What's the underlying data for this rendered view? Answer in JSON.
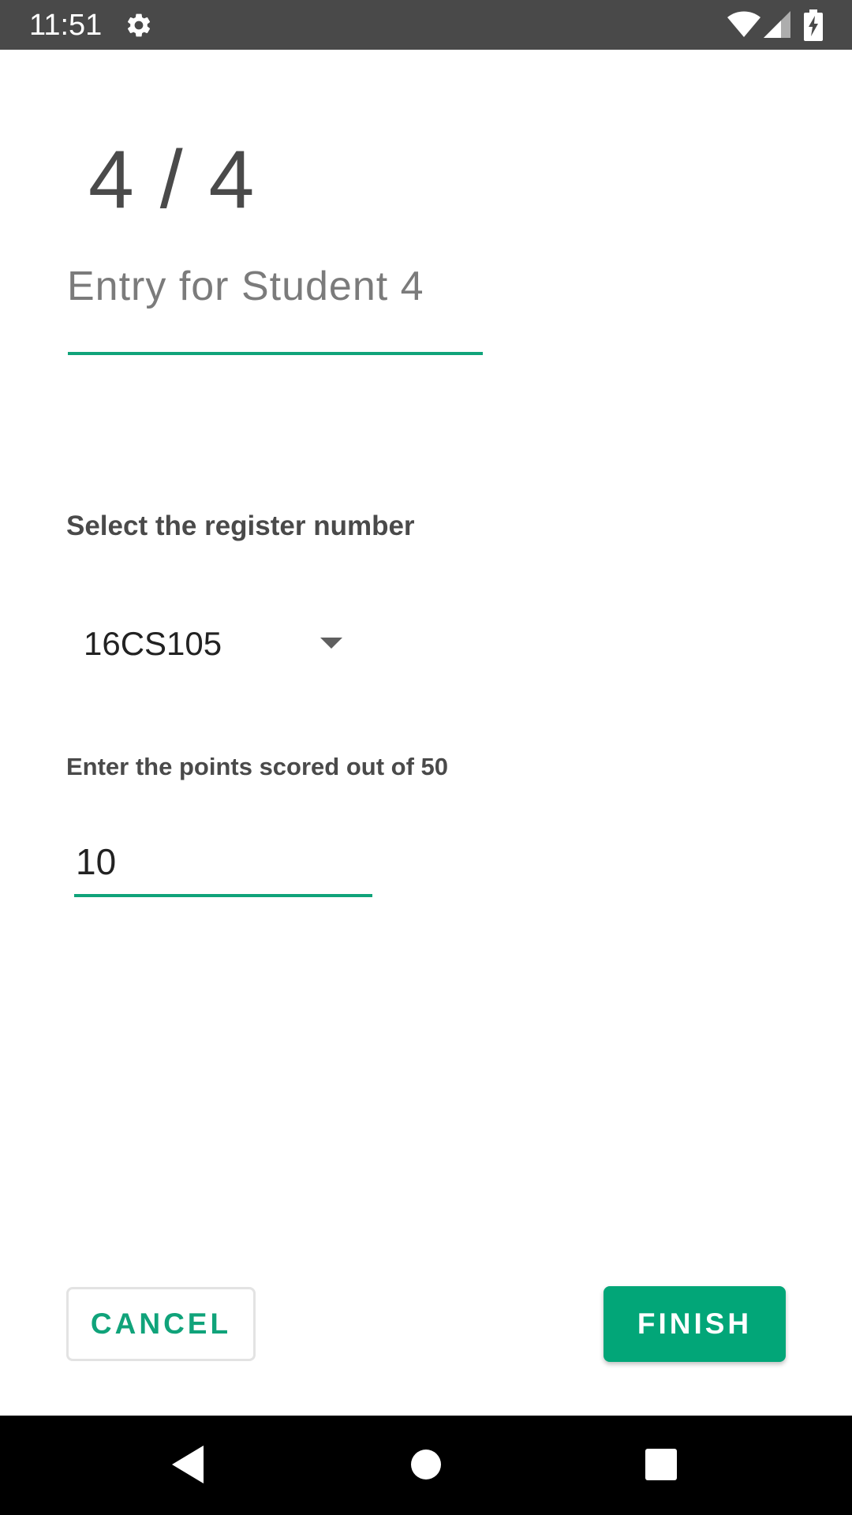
{
  "status_bar": {
    "time": "11:51",
    "icons": [
      "gear-icon",
      "wifi-icon",
      "signal-icon",
      "battery-charging-icon"
    ]
  },
  "header": {
    "counter": "4 / 4",
    "title": "Entry for Student 4"
  },
  "form": {
    "register_label": "Select the register number",
    "register_value": "16CS105",
    "points_label": "Enter the points scored out of 50",
    "points_value": "10"
  },
  "buttons": {
    "cancel": "CANCEL",
    "finish": "FINISH"
  },
  "nav_bar": {
    "icons": [
      "back-icon",
      "home-icon",
      "recents-icon"
    ]
  },
  "colors": {
    "accent": "#10a37a",
    "finish_bg": "#02a678",
    "status_bar_bg": "#494949",
    "text_dark": "#4a4a4a",
    "title_gray": "#7b7b7b"
  }
}
